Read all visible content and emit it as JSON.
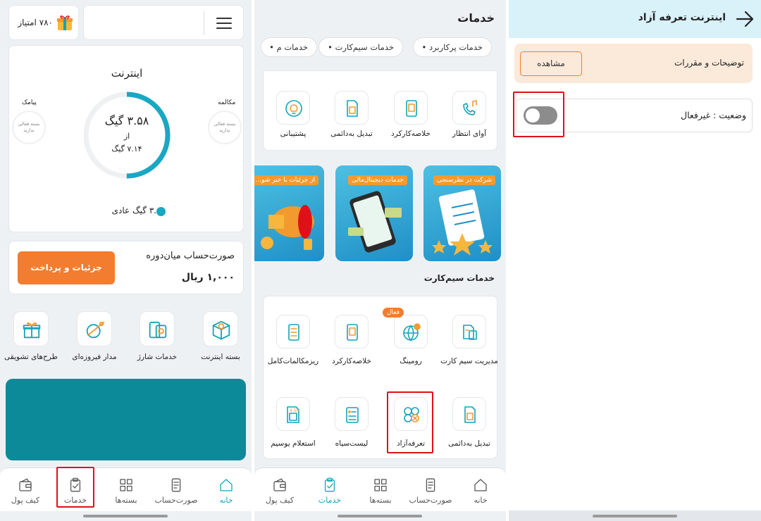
{
  "colors": {
    "teal": "#14a3b8",
    "orange": "#f27d31",
    "highlight": "#e0101a",
    "darkTeal": "#0d8a99"
  },
  "home": {
    "points_label": "۷۸۰ امتیاز",
    "internet_title": "اینترنت",
    "ring_value": "۳.۵۸ گیگ",
    "ring_of": "از",
    "ring_total": "۷.۱۴ گیگ",
    "usage_fraction": 0.5,
    "sms_label": "پیامک",
    "sms_sub": "بسته فعالی ندارید",
    "call_label": "مکالمه",
    "call_sub": "بسته فعالی ندارید",
    "legend": "۳.۵۸ گیگ عادی",
    "bill_title": "صورت‌حساب میان‌دوره",
    "bill_amount": "۱,۰۰۰ ریال",
    "pay_button": "جزئیات و پرداخت",
    "quick": [
      {
        "label": "بسته اینترنت",
        "icon": "internet-package-icon"
      },
      {
        "label": "خدمات شارژ",
        "icon": "charge-services-icon"
      },
      {
        "label": "مدار فیروزه‌ای",
        "icon": "turquoise-orbit-icon"
      },
      {
        "label": "طرح‌های تشویقی",
        "icon": "gift-plans-icon"
      }
    ]
  },
  "services": {
    "title": "خدمات",
    "chips": [
      "خدمات پرکاربرد",
      "خدمات سیم‌کارت",
      "خدمات م"
    ],
    "popular": [
      {
        "label": "آوای انتظار",
        "icon": "ringback-tone-icon"
      },
      {
        "label": "خلاصه‌کارکرد",
        "icon": "usage-summary-icon"
      },
      {
        "label": "تبدیل به‌دائمی",
        "icon": "convert-permanent-icon"
      },
      {
        "label": "پشتیبانی",
        "icon": "support-bulb-icon"
      }
    ],
    "banners": [
      "شرکت در نظرسنجی",
      "خدمات دیجیتال‌مالی",
      "از جزئیات با خبر شو..."
    ],
    "sim_title": "خدمات سیم‌کارت",
    "active_badge": "فعال",
    "sim_row1": [
      {
        "label": "مدیریت سیم کارت",
        "icon": "sim-management-icon"
      },
      {
        "label": "رومینگ",
        "icon": "roaming-globe-icon"
      },
      {
        "label": "خلاصه‌کارکرد",
        "icon": "usage-summary-icon"
      },
      {
        "label": "ریزمکالمات‌کامل",
        "icon": "call-details-icon"
      }
    ],
    "sim_row2": [
      {
        "label": "تبدیل به‌دائمی",
        "icon": "convert-permanent-icon"
      },
      {
        "label": "تعرفه‌آزاد",
        "icon": "free-tariff-icon"
      },
      {
        "label": "لیست‌سیاه",
        "icon": "blacklist-icon"
      },
      {
        "label": "استعلام یوسیم",
        "icon": "usim-inquiry-icon"
      }
    ]
  },
  "nav": [
    {
      "label": "خانه",
      "icon": "home-icon"
    },
    {
      "label": "صورت‌حساب",
      "icon": "bill-icon"
    },
    {
      "label": "بسته‌ها",
      "icon": "packages-grid-icon"
    },
    {
      "label": "خدمات",
      "icon": "services-clipboard-icon"
    },
    {
      "label": "کیف پول",
      "icon": "wallet-icon"
    }
  ],
  "detail": {
    "title": "اینترنت تعرفه آزاد",
    "terms_label": "توضیحات و مقررات",
    "view_button": "مشاهده",
    "status_label": "وضعیت : غیرفعال",
    "toggle_on": false
  }
}
